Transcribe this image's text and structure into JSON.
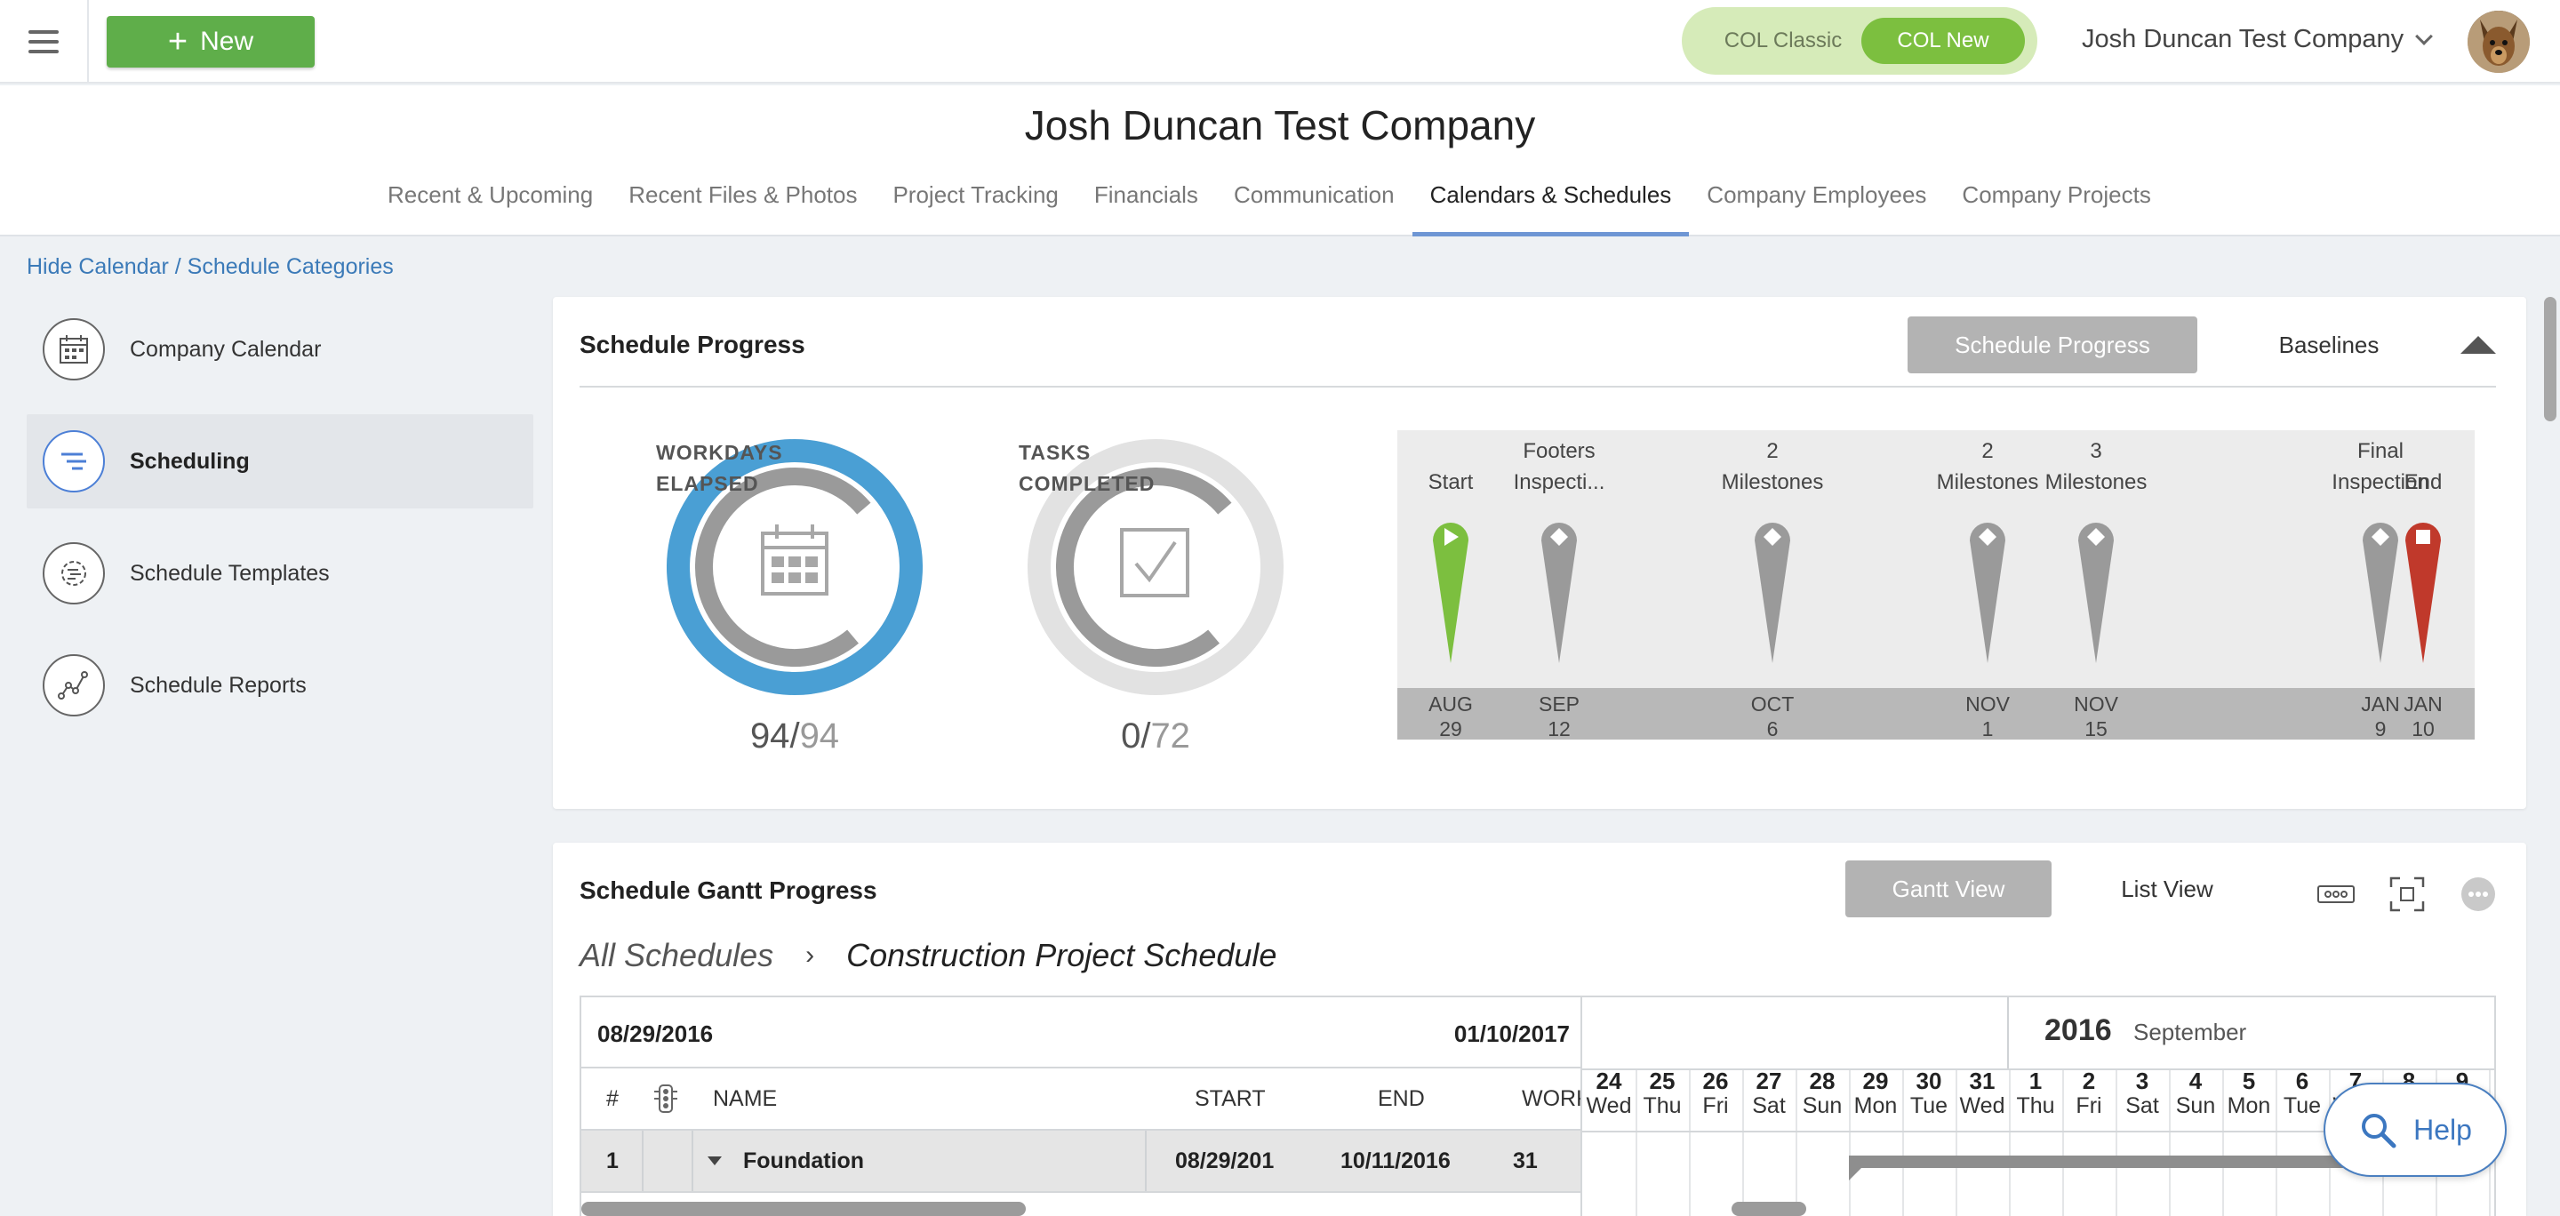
{
  "topbar": {
    "new_label": "New",
    "col_classic": "COL Classic",
    "col_new": "COL New",
    "company": "Josh Duncan Test Company"
  },
  "header": {
    "title": "Josh Duncan Test Company",
    "tabs": [
      "Recent & Upcoming",
      "Recent Files & Photos",
      "Project Tracking",
      "Financials",
      "Communication",
      "Calendars & Schedules",
      "Company Employees",
      "Company Projects"
    ],
    "active_tab": "Calendars & Schedules"
  },
  "breadcrumb": {
    "hide_calendar": "Hide Calendar",
    "separator": " / ",
    "schedule_categories": "Schedule Categories"
  },
  "sidebar": {
    "items": [
      {
        "label": "Company Calendar",
        "icon": "calendar-icon"
      },
      {
        "label": "Scheduling",
        "icon": "scheduling-icon",
        "active": true
      },
      {
        "label": "Schedule Templates",
        "icon": "template-gear-icon"
      },
      {
        "label": "Schedule Reports",
        "icon": "report-chart-icon"
      }
    ]
  },
  "progress": {
    "title": "Schedule Progress",
    "btn_progress": "Schedule Progress",
    "btn_baselines": "Baselines",
    "workdays": {
      "label_line1": "WORKDAYS",
      "label_line2": "ELAPSED",
      "value": "94",
      "total": "94",
      "fraction": 1.0
    },
    "tasks": {
      "label_line1": "TASKS",
      "label_line2": "COMPLETED",
      "value": "0",
      "total": "72",
      "fraction": 0.0
    },
    "milestones": [
      {
        "line1": "",
        "line2": "Start",
        "month": "AUG",
        "day": "29",
        "kind": "start"
      },
      {
        "line1": "Footers",
        "line2": "Inspecti...",
        "month": "SEP",
        "day": "12",
        "kind": "milestone"
      },
      {
        "line1": "2",
        "line2": "Milestones",
        "month": "OCT",
        "day": "6",
        "kind": "milestone"
      },
      {
        "line1": "2",
        "line2": "Milestones",
        "month": "NOV",
        "day": "1",
        "kind": "milestone"
      },
      {
        "line1": "3",
        "line2": "Milestones",
        "month": "NOV",
        "day": "15",
        "kind": "milestone"
      },
      {
        "line1": "Final",
        "line2": "Inspection",
        "month": "JAN",
        "day": "9",
        "kind": "milestone"
      },
      {
        "line1": "",
        "line2": "End",
        "month": "JAN",
        "day": "10",
        "kind": "end"
      }
    ],
    "colors": {
      "workdays": "#4a9fd4",
      "inner": "#9a9a9a",
      "track": "#e2e2e2",
      "start_pin": "#7cbf3f",
      "end_pin": "#c0392b",
      "pin": "#9a9a9a"
    }
  },
  "gantt": {
    "title": "Schedule Gantt Progress",
    "btn_gantt": "Gantt View",
    "btn_list": "List View",
    "crumb_root": "All Schedules",
    "crumb_current": "Construction Project Schedule",
    "start_date": "08/29/2016",
    "end_date": "01/10/2017",
    "columns": {
      "num": "#",
      "name": "NAME",
      "start": "START",
      "end": "END",
      "work": "WORK"
    },
    "rows": [
      {
        "num": "1",
        "name": "Foundation",
        "start": "08/29/201",
        "end": "10/11/2016",
        "work": "31"
      }
    ],
    "calendar": {
      "year": "2016",
      "month": "September",
      "days": [
        {
          "n": "24",
          "w": "Wed"
        },
        {
          "n": "25",
          "w": "Thu"
        },
        {
          "n": "26",
          "w": "Fri"
        },
        {
          "n": "27",
          "w": "Sat"
        },
        {
          "n": "28",
          "w": "Sun"
        },
        {
          "n": "29",
          "w": "Mon"
        },
        {
          "n": "30",
          "w": "Tue"
        },
        {
          "n": "31",
          "w": "Wed"
        },
        {
          "n": "1",
          "w": "Thu"
        },
        {
          "n": "2",
          "w": "Fri"
        },
        {
          "n": "3",
          "w": "Sat"
        },
        {
          "n": "4",
          "w": "Sun"
        },
        {
          "n": "5",
          "w": "Mon"
        },
        {
          "n": "6",
          "w": "Tue"
        },
        {
          "n": "7",
          "w": "Wed"
        },
        {
          "n": "8",
          "w": "Thu"
        },
        {
          "n": "9",
          "w": "Fri"
        }
      ]
    }
  },
  "help_label": "Help"
}
